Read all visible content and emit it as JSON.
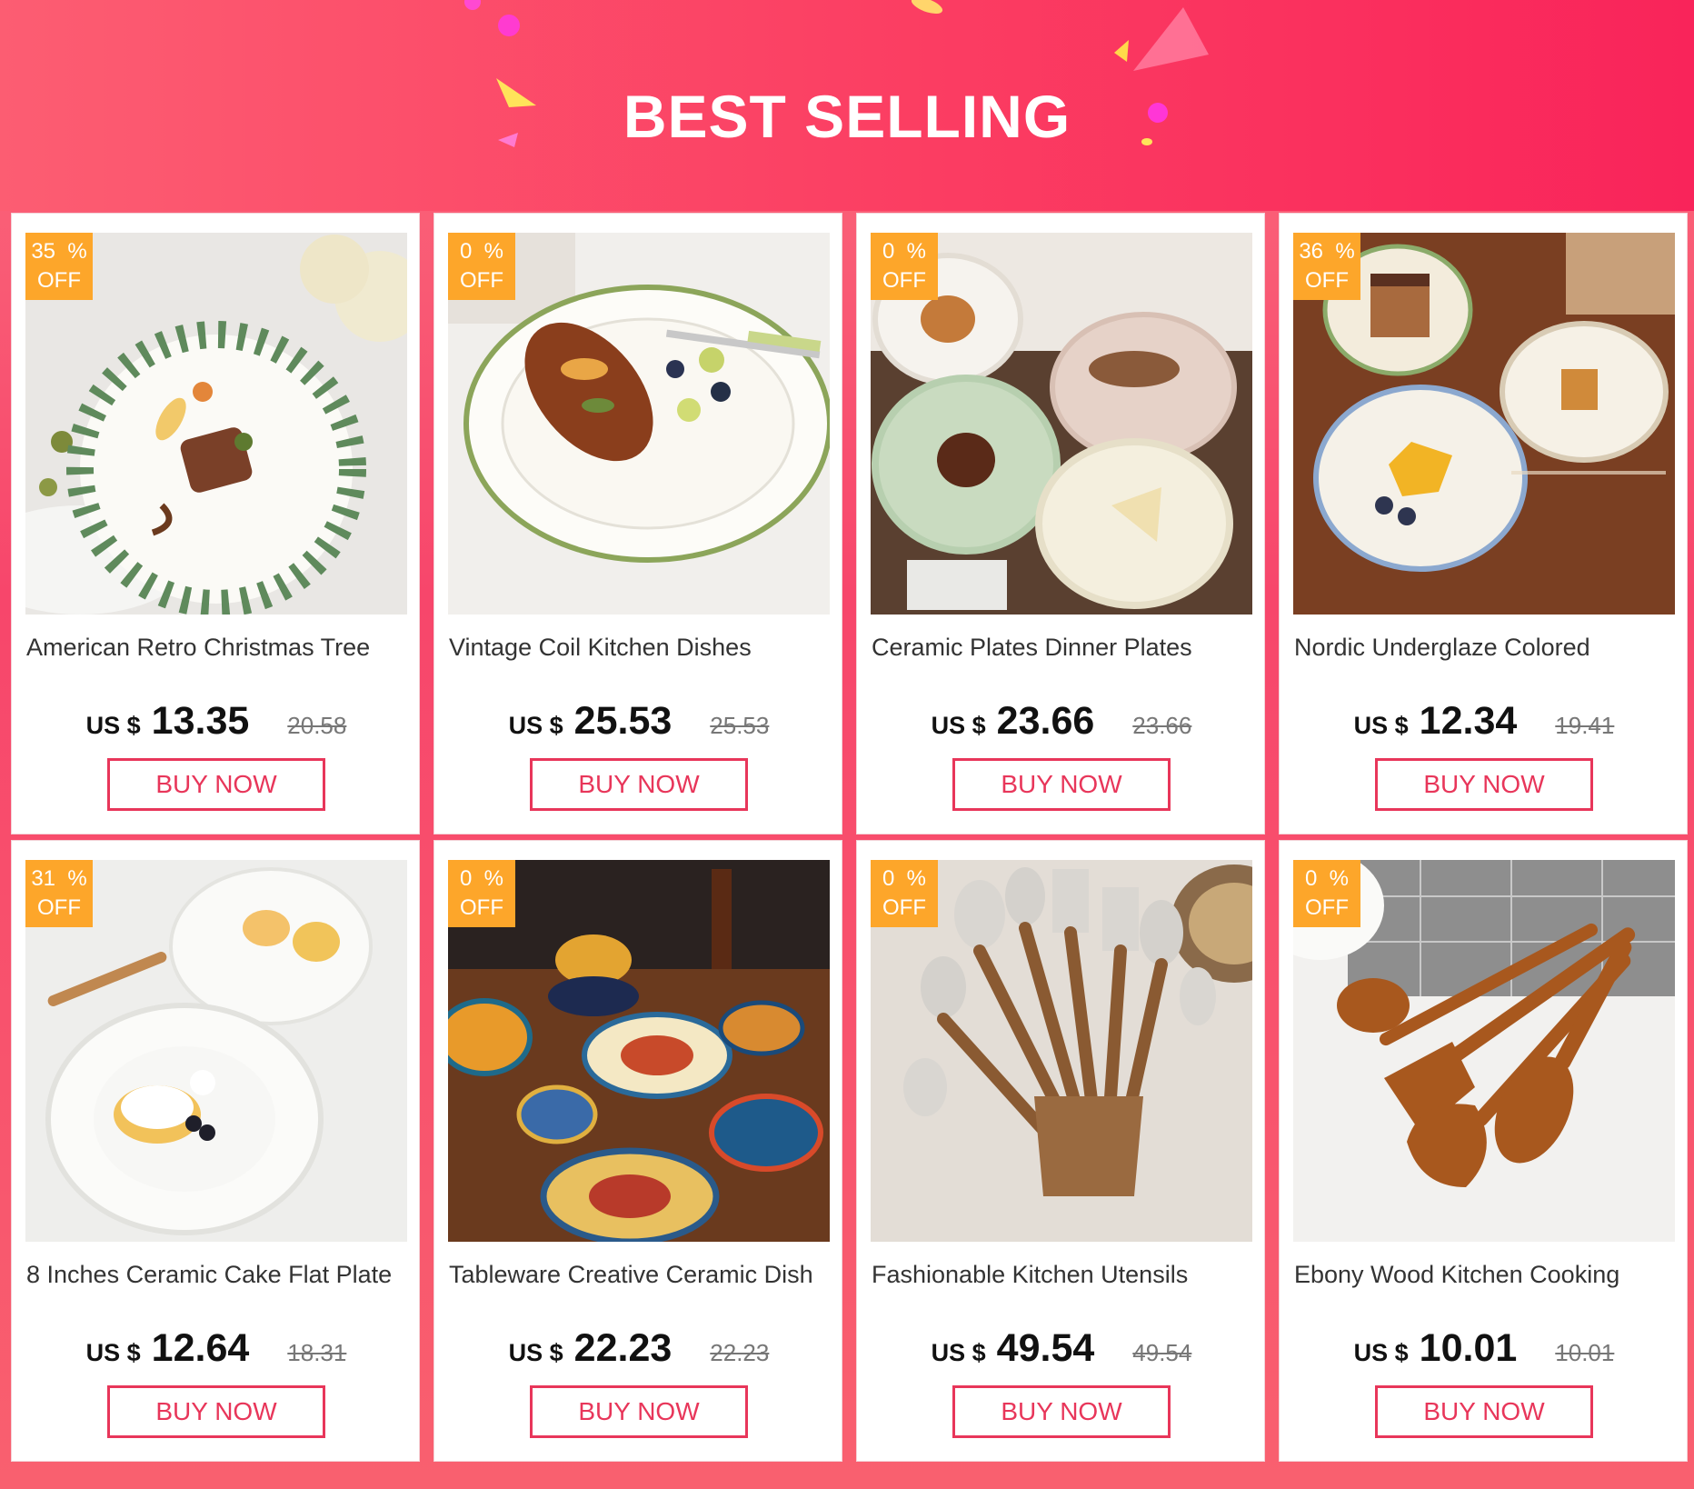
{
  "header": {
    "title": "BEST SELLING"
  },
  "colors": {
    "accent": "#e8365a",
    "badge": "#fda62a",
    "background": "#f7466b"
  },
  "products": [
    {
      "discount": "35  %",
      "off": "OFF",
      "name": "American Retro Christmas Tree",
      "currency": "US $",
      "price": "13.35",
      "old_price": "20.58",
      "buy_label": "BUY NOW"
    },
    {
      "discount": "0  %",
      "off": "OFF",
      "name": "Vintage Coil Kitchen Dishes",
      "currency": "US $",
      "price": "25.53",
      "old_price": "25.53",
      "buy_label": "BUY NOW"
    },
    {
      "discount": "0  %",
      "off": "OFF",
      "name": "Ceramic Plates Dinner Plates",
      "currency": "US $",
      "price": "23.66",
      "old_price": "23.66",
      "buy_label": "BUY NOW"
    },
    {
      "discount": "36  %",
      "off": "OFF",
      "name": "Nordic Underglaze Colored",
      "currency": "US $",
      "price": "12.34",
      "old_price": "19.41",
      "buy_label": "BUY NOW"
    },
    {
      "discount": "31  %",
      "off": "OFF",
      "name": "8 Inches Ceramic Cake Flat Plate",
      "currency": "US $",
      "price": "12.64",
      "old_price": "18.31",
      "buy_label": "BUY NOW"
    },
    {
      "discount": "0  %",
      "off": "OFF",
      "name": "Tableware Creative Ceramic Dish",
      "currency": "US $",
      "price": "22.23",
      "old_price": "22.23",
      "buy_label": "BUY NOW"
    },
    {
      "discount": "0  %",
      "off": "OFF",
      "name": "Fashionable Kitchen Utensils",
      "currency": "US $",
      "price": "49.54",
      "old_price": "49.54",
      "buy_label": "BUY NOW"
    },
    {
      "discount": "0  %",
      "off": "OFF",
      "name": "Ebony Wood Kitchen Cooking",
      "currency": "US $",
      "price": "10.01",
      "old_price": "10.01",
      "buy_label": "BUY NOW"
    }
  ]
}
